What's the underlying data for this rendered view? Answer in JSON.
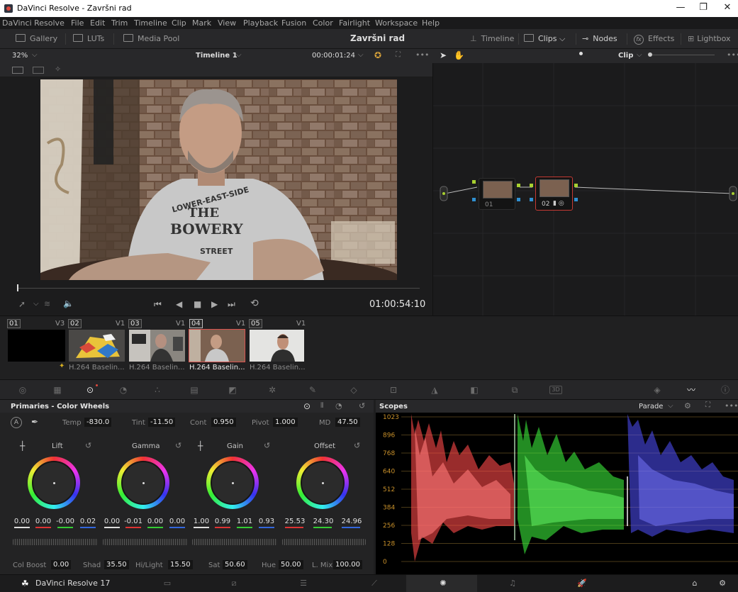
{
  "window": {
    "title": "DaVinci Resolve - Završni rad",
    "min": "—",
    "max": "❐",
    "close": "✕"
  },
  "menu": [
    "DaVinci Resolve",
    "File",
    "Edit",
    "Trim",
    "Timeline",
    "Clip",
    "Mark",
    "View",
    "Playback",
    "Fusion",
    "Color",
    "Fairlight",
    "Workspace",
    "Help"
  ],
  "toolbar": {
    "gallery": "Gallery",
    "luts": "LUTs",
    "media_pool": "Media Pool",
    "project": "Završni rad",
    "timeline": "Timeline",
    "clips": "Clips",
    "nodes": "Nodes",
    "effects": "Effects",
    "lightbox": "Lightbox"
  },
  "viewer": {
    "zoom": "32%",
    "timeline_name": "Timeline 1",
    "timecode_top": "00:00:01:24",
    "timecode": "01:00:54:10",
    "shirt_text_1": "LOWER-EAST-SIDE",
    "shirt_text_2": "THE",
    "shirt_text_3": "BOWERY",
    "shirt_text_4": "STREET"
  },
  "nodes": {
    "mode": "Clip",
    "node1": "01",
    "node2": "02"
  },
  "clips": [
    {
      "num": "01",
      "track": "V3",
      "label": ""
    },
    {
      "num": "02",
      "track": "V1",
      "label": "H.264 Baselin..."
    },
    {
      "num": "03",
      "track": "V1",
      "label": "H.264 Baselin..."
    },
    {
      "num": "04",
      "track": "V1",
      "label": "H.264 Baselin..."
    },
    {
      "num": "05",
      "track": "V1",
      "label": "H.264 Baselin..."
    }
  ],
  "primaries": {
    "title": "Primaries - Color Wheels",
    "temp_label": "Temp",
    "temp": "-830.0",
    "tint_label": "Tint",
    "tint": "-11.50",
    "cont_label": "Cont",
    "cont": "0.950",
    "pivot_label": "Pivot",
    "pivot": "1.000",
    "md_label": "MD",
    "md": "47.50",
    "wheels": [
      {
        "name": "Lift",
        "values": [
          "0.00",
          "0.00",
          "-0.00",
          "0.02"
        ]
      },
      {
        "name": "Gamma",
        "values": [
          "0.00",
          "-0.01",
          "0.00",
          "0.00"
        ]
      },
      {
        "name": "Gain",
        "values": [
          "1.00",
          "0.99",
          "1.01",
          "0.93"
        ]
      },
      {
        "name": "Offset",
        "values": [
          "25.53",
          "24.30",
          "24.96"
        ]
      }
    ],
    "colboost_label": "Col Boost",
    "colboost": "0.00",
    "shad_label": "Shad",
    "shad": "35.50",
    "hilight_label": "Hi/Light",
    "hilight": "15.50",
    "sat_label": "Sat",
    "sat": "50.60",
    "hue_label": "Hue",
    "hue": "50.00",
    "lmix_label": "L. Mix",
    "lmix": "100.00"
  },
  "scopes": {
    "title": "Scopes",
    "mode": "Parade",
    "ticks": [
      "1023",
      "896",
      "768",
      "640",
      "512",
      "384",
      "256",
      "128",
      "0"
    ]
  },
  "bottom": {
    "app": "DaVinci Resolve 17"
  }
}
